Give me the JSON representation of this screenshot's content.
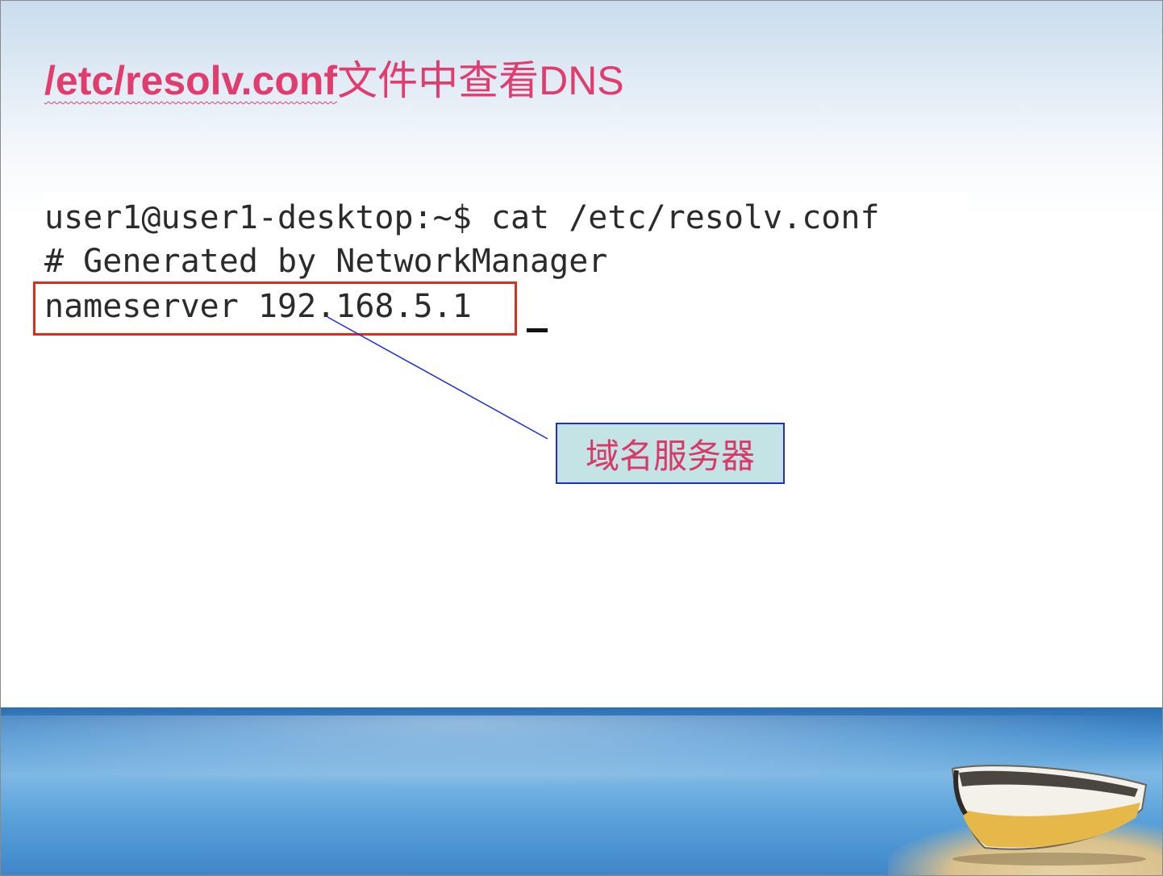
{
  "title": {
    "path": "/etc/resolv.conf",
    "text": "文件中查看DNS"
  },
  "terminal": {
    "line1": "user1@user1-desktop:~$ cat /etc/resolv.conf",
    "line2": "# Generated by NetworkManager",
    "line3": "nameserver 192.168.5.1"
  },
  "callout": {
    "label": "域名服务器"
  },
  "colors": {
    "title": "#e03c6e",
    "highlight_border": "#d9301e",
    "callout_border": "#1d2fd4",
    "callout_fill": "#c4e3e4",
    "leader_line": "#1d2fd4"
  },
  "decor": {
    "footer_image": "sea-and-boat-banner"
  }
}
